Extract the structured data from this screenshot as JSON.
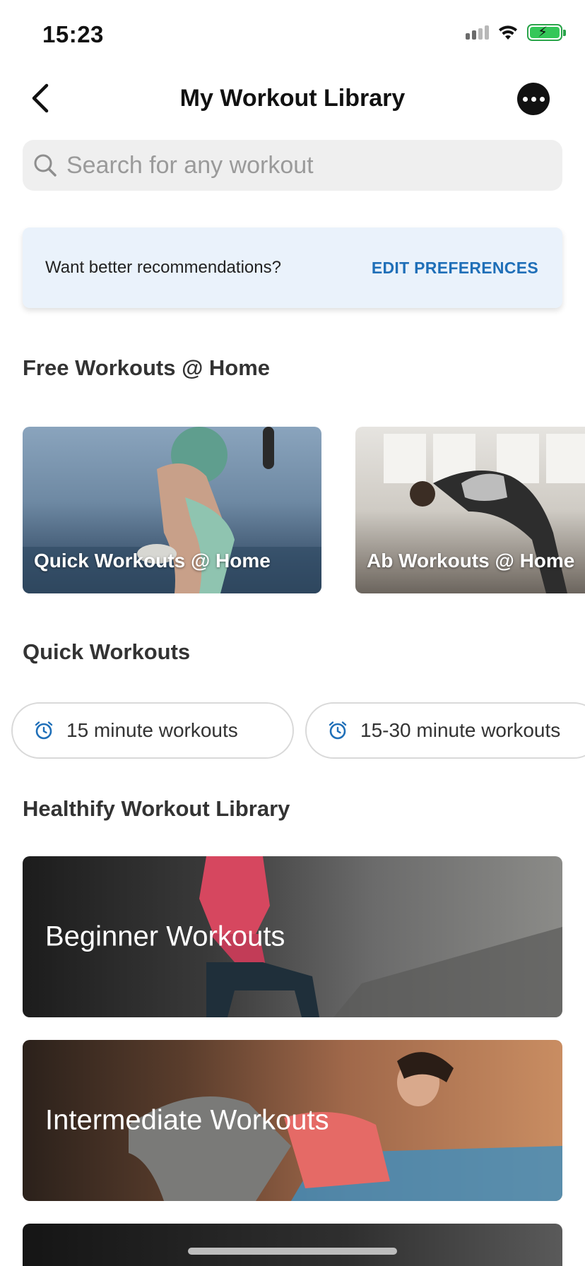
{
  "status": {
    "time": "15:23"
  },
  "header": {
    "title": "My Workout Library"
  },
  "search": {
    "placeholder": "Search for any workout"
  },
  "banner": {
    "text": "Want better recommendations?",
    "link": "EDIT PREFERENCES"
  },
  "sections": {
    "free_home": {
      "title": "Free Workouts @ Home",
      "cards": [
        {
          "label": "Quick Workouts @ Home"
        },
        {
          "label": "Ab Workouts @ Home"
        }
      ]
    },
    "quick": {
      "title": "Quick Workouts",
      "chips": [
        {
          "label": "15 minute workouts",
          "icon": "alarm-clock-icon"
        },
        {
          "label": "15-30 minute workouts",
          "icon": "alarm-clock-icon"
        }
      ]
    },
    "library": {
      "title": "Healthify Workout Library",
      "cards": [
        {
          "label": "Beginner Workouts"
        },
        {
          "label": "Intermediate Workouts"
        }
      ]
    }
  },
  "colors": {
    "accent": "#1f6fb8",
    "banner_bg": "#eaf2fb",
    "battery": "#34c759"
  }
}
